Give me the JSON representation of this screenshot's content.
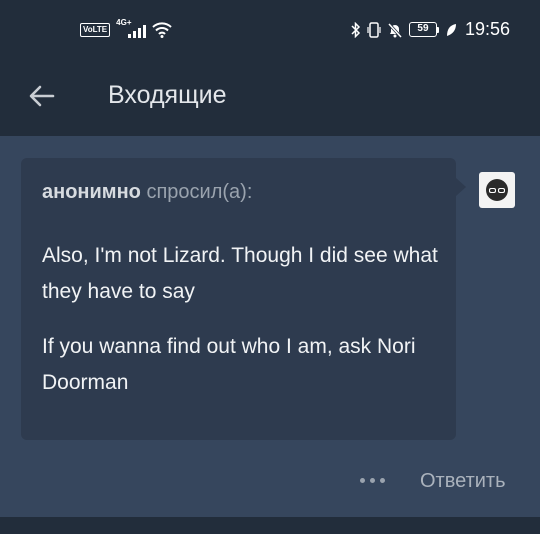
{
  "status_bar": {
    "volte": "VoLTE",
    "network": "4G+",
    "battery": "59",
    "time": "19:56",
    "icons": [
      "volte-icon",
      "signal-icon",
      "wifi-icon",
      "bluetooth-icon",
      "vibrate-icon",
      "mute-bell-icon",
      "battery-icon",
      "leaf-icon"
    ]
  },
  "app_bar": {
    "back_icon": "arrow-left-icon",
    "title": "Входящие"
  },
  "ask": {
    "asker": "анонимно",
    "verb": "спросил(а):",
    "paragraphs": [
      "Also, I'm not Lizard. Though I did see what they have to say",
      "If you wanna find out who I am, ask Nori Doorman"
    ]
  },
  "actions": {
    "more_icon": "more-dots-icon",
    "reply_label": "Ответить"
  },
  "colors": {
    "background": "#36465d",
    "header": "#222d3b",
    "card": "#2e3b4f"
  }
}
